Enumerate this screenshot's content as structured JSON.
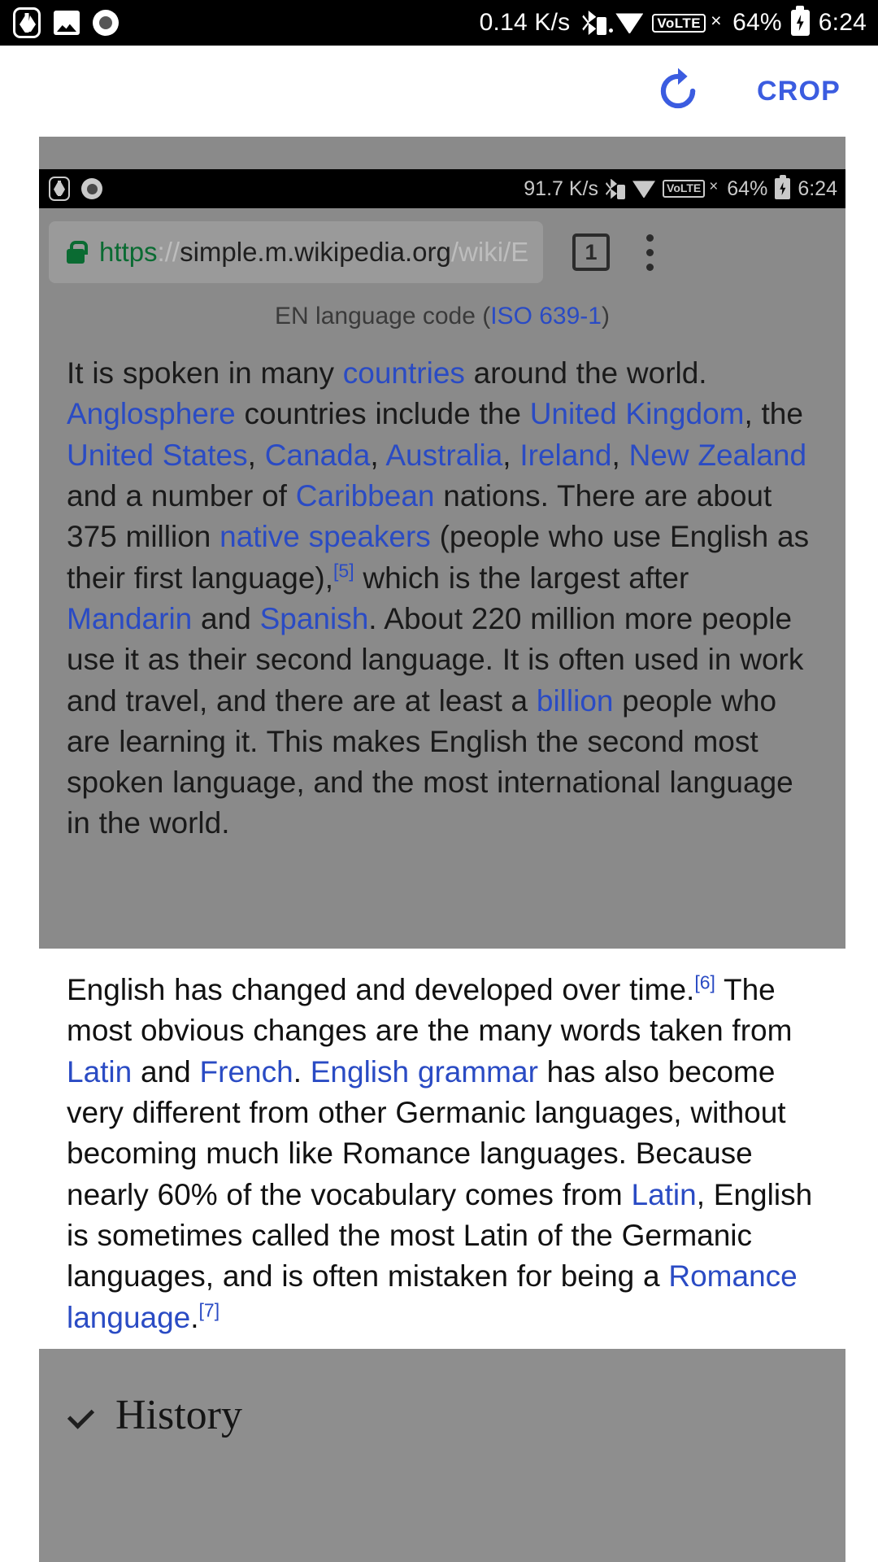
{
  "system_status_bar": {
    "icons_left": [
      "leaf-app-icon",
      "gallery-icon",
      "screen-record-icon"
    ],
    "network_speed": "0.14 K/s",
    "bluetooth": "bluetooth-icon",
    "wifi": "wifi-icon",
    "volte": "VoLTE",
    "signal_1": "signal-no-service-icon",
    "signal_2": "signal-bars-icon",
    "battery_percent": "64%",
    "battery": "battery-charging-icon",
    "time": "6:24"
  },
  "editor_toolbar": {
    "rotate_icon": "rotate-right-icon",
    "crop_label": "CROP",
    "accent_color": "#3b5ce0"
  },
  "screenshot": {
    "status_bar": {
      "icons_left": [
        "leaf-app-icon",
        "screen-record-icon"
      ],
      "network_speed": "91.7 K/s",
      "bluetooth": "bluetooth-icon",
      "wifi": "wifi-icon",
      "volte": "VoLTE",
      "signal_1": "signal-no-service-icon",
      "signal_2": "signal-bars-icon",
      "battery_percent": "64%",
      "battery": "battery-charging-icon",
      "time": "6:24"
    },
    "browser": {
      "lock_icon": "lock-icon",
      "url_scheme": "https",
      "url_separator": "://",
      "url_host": "simple.m.wikipedia.org",
      "url_path": "/wiki/E",
      "tab_count": "1",
      "menu_icon": "kebab-menu-icon"
    },
    "article": {
      "caption_prefix": "EN language code (",
      "caption_link": "ISO 639-1",
      "caption_suffix": ")",
      "paragraph_1": [
        {
          "t": "It is spoken in many "
        },
        {
          "t": "countries",
          "link": true
        },
        {
          "t": " around the world. "
        },
        {
          "t": "Anglosphere",
          "link": true
        },
        {
          "t": " countries include the "
        },
        {
          "t": "United Kingdom",
          "link": true
        },
        {
          "t": ", the "
        },
        {
          "t": "United States",
          "link": true
        },
        {
          "t": ", "
        },
        {
          "t": "Canada",
          "link": true
        },
        {
          "t": ", "
        },
        {
          "t": "Australia",
          "link": true
        },
        {
          "t": ", "
        },
        {
          "t": "Ireland",
          "link": true
        },
        {
          "t": ", "
        },
        {
          "t": "New Zealand",
          "link": true
        },
        {
          "t": " and a number of "
        },
        {
          "t": "Caribbean",
          "link": true
        },
        {
          "t": " nations. There are about 375 million "
        },
        {
          "t": "native speakers",
          "link": true
        },
        {
          "t": " (people who use English as their first language),"
        },
        {
          "t": "[5]",
          "sup": true
        },
        {
          "t": " which is the largest after "
        },
        {
          "t": "Mandarin",
          "link": true
        },
        {
          "t": " and "
        },
        {
          "t": "Spanish",
          "link": true
        },
        {
          "t": ". About 220 million more people use it as their second language. It is often used in work and travel, and there are at least a "
        },
        {
          "t": "billion",
          "link": true
        },
        {
          "t": " people who are learning it. This makes English the second most spoken language, and the most international language in the world."
        }
      ],
      "paragraph_2": [
        {
          "t": "English has changed and developed over time."
        },
        {
          "t": "[6]",
          "sup": true
        },
        {
          "t": " The most obvious changes are the many words taken from "
        },
        {
          "t": "Latin",
          "link": true
        },
        {
          "t": " and "
        },
        {
          "t": "French",
          "link": true
        },
        {
          "t": ". "
        },
        {
          "t": "English grammar",
          "link": true
        },
        {
          "t": " has also become very different from other Germanic languages, without becoming much like Romance languages. Because nearly 60% of the vocabulary comes from "
        },
        {
          "t": "Latin",
          "link": true
        },
        {
          "t": ", English is sometimes called the most Latin of the Germanic languages, and is often mistaken for being a "
        },
        {
          "t": "Romance language",
          "link": true
        },
        {
          "t": "."
        },
        {
          "t": "[7]",
          "sup": true
        }
      ],
      "section_history": {
        "chevron_icon": "chevron-down-icon",
        "label": "History"
      }
    }
  }
}
